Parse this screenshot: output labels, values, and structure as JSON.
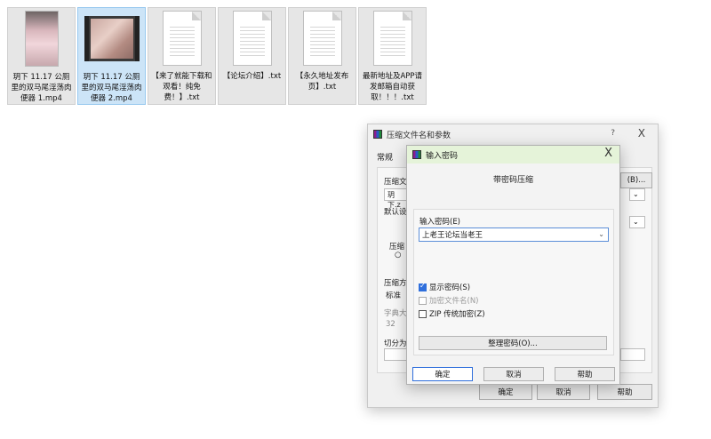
{
  "files": [
    {
      "name": "玥下 11.17 公厕里的双马尾淫荡肉便器 1.mp4",
      "type": "photo",
      "selected": false
    },
    {
      "name": "玥下 11.17 公厕里的双马尾淫荡肉便器 2.mp4",
      "type": "video",
      "selected": true
    },
    {
      "name": "【来了就能下载和观看！纯免费！】.txt",
      "type": "doc",
      "selected": false
    },
    {
      "name": "【论坛介绍】.txt",
      "type": "doc",
      "selected": false
    },
    {
      "name": "【永久地址发布页】.txt",
      "type": "doc",
      "selected": false
    },
    {
      "name": "最新地址及APP请发邮箱自动获取！！！.txt",
      "type": "doc",
      "selected": false
    }
  ],
  "outer_dialog": {
    "title": "压缩文件名和参数",
    "help_icon": "?",
    "close_icon": "X",
    "tab_general": "常规",
    "label_archive": "压缩文",
    "archive_value": "玥下.z",
    "browse_label": "(B)...",
    "label_default": "默认设",
    "label_archive_format": "压缩",
    "label_method": "压缩方",
    "method_value": "标准",
    "label_dict": "字典大",
    "dict_value": "32",
    "label_split": "切分为",
    "ok": "确定",
    "cancel": "取消",
    "help": "帮助"
  },
  "inner_dialog": {
    "title": "输入密码",
    "close_icon": "X",
    "heading": "带密码压缩",
    "password_label": "输入密码(E)",
    "password_value": "上老王论坛当老王",
    "show_password": {
      "label": "显示密码(S)",
      "checked": true
    },
    "encrypt_names": {
      "label": "加密文件名(N)",
      "checked": false,
      "disabled": true
    },
    "zip_legacy": {
      "label": "ZIP 传统加密(Z)",
      "checked": false
    },
    "organize_button": "整理密码(O)...",
    "ok": "确定",
    "cancel": "取消",
    "help": "帮助"
  },
  "colors": {
    "selected_file_bg": "#cce4f7",
    "inner_titlebar_bg": "#e5f3d9",
    "accent": "#2f6fdc"
  }
}
